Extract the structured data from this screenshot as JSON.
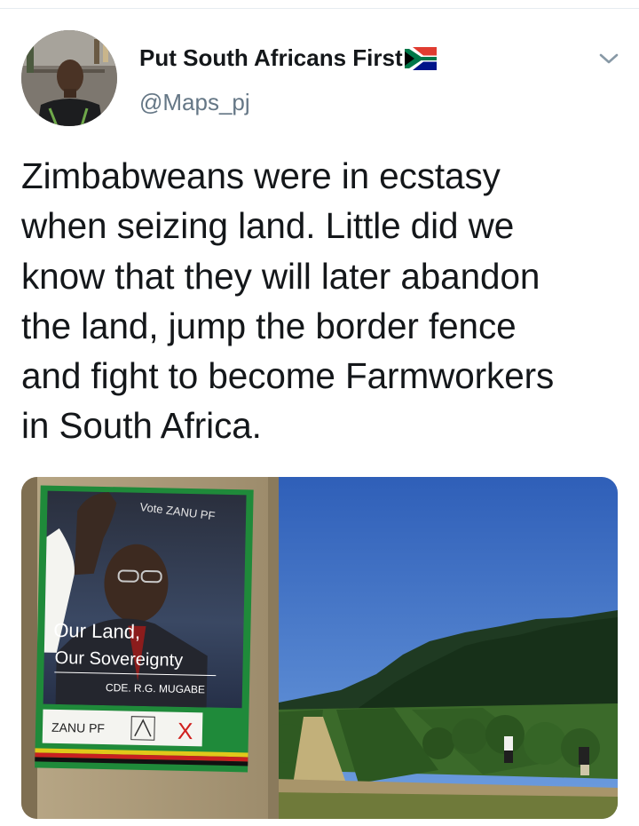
{
  "tweet": {
    "display_name": "Put South Africans First",
    "handle": "@Maps_pj",
    "text": "Zimbabweans were in ecstasy\nwhen seizing land. Little did we\nknow that they will later abandon\nthe land, jump the border fence\nand fight to become Farmworkers\nin South Africa."
  },
  "icons": {
    "flag": "south-africa-flag-icon",
    "menu": "chevron-down-icon"
  },
  "media": {
    "poster": {
      "vote_text": "Vote ZANU PF",
      "slogan_line1": "Our Land,",
      "slogan_line2": "Our Sovereignty",
      "signature": "CDE. R.G. MUGABE",
      "party": "ZANU PF",
      "mark": "X"
    }
  },
  "colors": {
    "text_primary": "#14171a",
    "text_secondary": "#657786",
    "divider": "#e6ecf0"
  }
}
